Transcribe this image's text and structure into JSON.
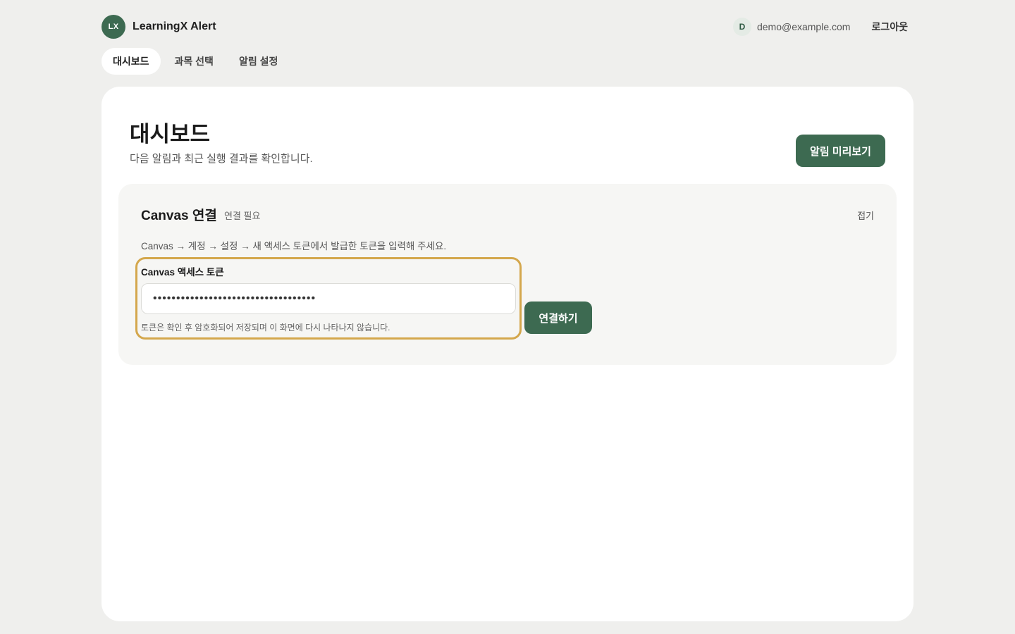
{
  "header": {
    "logo_text": "LX",
    "app_name": "LearningX Alert",
    "user_initial": "D",
    "user_email": "demo@example.com",
    "logout_label": "로그아웃"
  },
  "tabs": [
    {
      "label": "대시보드",
      "active": true
    },
    {
      "label": "과목 선택",
      "active": false
    },
    {
      "label": "알림 설정",
      "active": false
    }
  ],
  "main": {
    "title": "대시보드",
    "subtitle": "다음 알림과 최근 실행 결과를 확인합니다.",
    "preview_button": "알림 미리보기"
  },
  "canvas_panel": {
    "title": "Canvas 연결",
    "status": "연결 필요",
    "collapse_label": "접기",
    "instruction": "Canvas → 계정 → 설정 → 새 액세스 토큰에서 발급한 토큰을 입력해 주세요.",
    "field_label": "Canvas 액세스 토큰",
    "token_value": "•••••••••••••••••••••••••••••••••••",
    "hint": "토큰은 확인 후 암호화되어 저장되며 이 화면에 다시 나타나지 않습니다.",
    "connect_button": "연결하기"
  },
  "colors": {
    "brand": "#3d6a51",
    "highlight": "#d4a74c",
    "page_bg": "#efefed"
  }
}
